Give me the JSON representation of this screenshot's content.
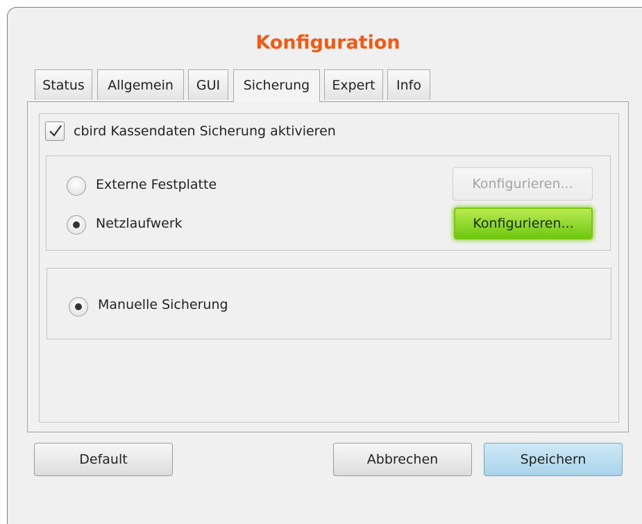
{
  "window": {
    "title": "Konfiguration",
    "title_color": "#f05a12"
  },
  "tabs": [
    {
      "label": "Status",
      "active": false
    },
    {
      "label": "Allgemein",
      "active": false
    },
    {
      "label": "GUI",
      "active": false
    },
    {
      "label": "Sicherung",
      "active": true
    },
    {
      "label": "Expert",
      "active": false
    },
    {
      "label": "Info",
      "active": false
    }
  ],
  "backup": {
    "enable_checkbox": {
      "label": "cbird Kassendaten Sicherung aktivieren",
      "checked": true
    },
    "targets": [
      {
        "label": "Externe Festplatte",
        "selected": false,
        "button_label": "Konfigurieren...",
        "button_enabled": false
      },
      {
        "label": "Netzlaufwerk",
        "selected": true,
        "button_label": "Konfigurieren...",
        "button_enabled": true,
        "button_highlight": "#7ac70f"
      }
    ],
    "manual": {
      "label": "Manuelle Sicherung",
      "selected": true
    }
  },
  "footer": {
    "default_label": "Default",
    "cancel_label": "Abbrechen",
    "save_label": "Speichern",
    "save_color": "#a9d3ea"
  }
}
